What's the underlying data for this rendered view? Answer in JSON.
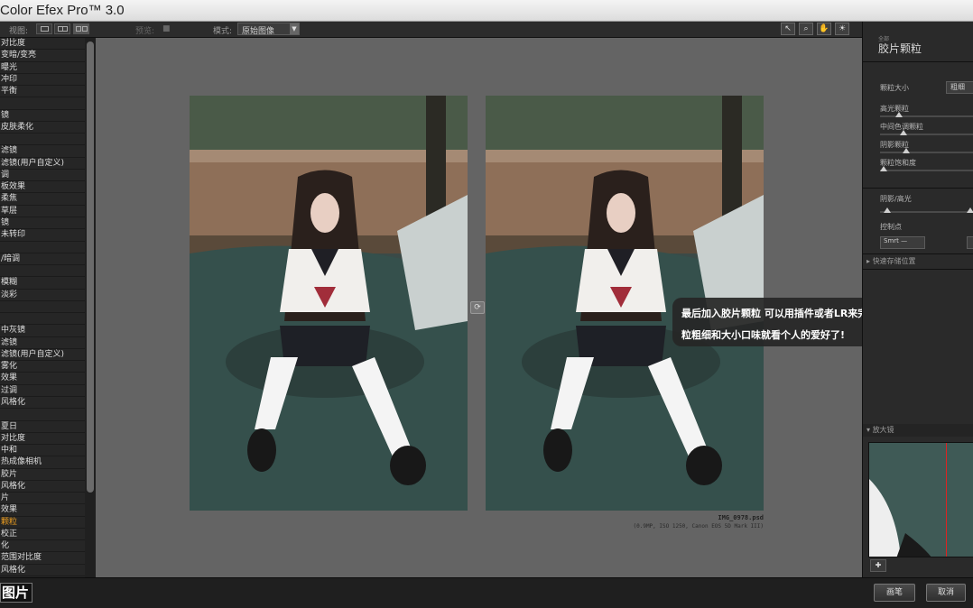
{
  "window": {
    "title": "Color Efex Pro™ 3.0"
  },
  "toolbar": {
    "view_label": "视图:",
    "preview_label": "预览:",
    "mode_label": "模式:",
    "mode_value": "原始图像"
  },
  "filter_list": [
    "对比度",
    "变暗/变亮",
    "曝光",
    "冲印",
    "平衡",
    "",
    "镜",
    "皮肤柔化",
    "",
    "滤镜",
    "滤镜(用户自定义)",
    "调",
    "板效果",
    "柔焦",
    "草层",
    "镜",
    "未转印",
    "",
    "/暗调",
    "",
    "模糊",
    "淡彩",
    "",
    "",
    "中灰镜",
    "滤镜",
    "滤镜(用户自定义)",
    "雾化",
    "效果",
    "过调",
    "风格化",
    "",
    "夏日",
    "对比度",
    "中和",
    "热成像相机",
    "胶片",
    "风格化",
    "片",
    "效果",
    "颗粒",
    "校正",
    "化",
    "范围对比度",
    "风格化"
  ],
  "filter_highlight": "颗粒",
  "preview": {
    "filename": "IMG_0978.psd",
    "fileinfo": "(0.9MP, ISO 1250, Canon EOS 5D Mark III)"
  },
  "caption": {
    "line1": "最后加入胶片颗粒 可以用插件或者LR来完成 至于颗",
    "line2": "粒粗细和大小口味就看个人的爱好了!"
  },
  "right_panel": {
    "category": "全部",
    "title": "胶片颗粒",
    "grain_size_label": "颗粒大小",
    "grain_size_value": "粗细",
    "sliders": [
      {
        "label": "高光颗粒",
        "value": 0.17
      },
      {
        "label": "中间色调颗粒",
        "value": 0.22
      },
      {
        "label": "阴影颗粒",
        "value": 0.25
      },
      {
        "label": "颗粒饱和度",
        "value": 0.0
      }
    ],
    "shadow_highlight_label": "阴影/高光",
    "control_points_label": "控制点",
    "control_points_button": "Smrt —",
    "quick_save_label": "快速存储位置",
    "loupe_label": "放大镜"
  },
  "bottom": {
    "left_label": "图片",
    "brush_label": "画笔",
    "cancel_label": "取消"
  },
  "colors": {
    "highlight": "#f0a020",
    "panel": "#2a2a2a",
    "preview_bg": "#646464"
  },
  "icons": [
    "single-view-icon",
    "split-view-icon",
    "side-by-side-icon",
    "pointer-icon",
    "zoom-icon",
    "hand-icon",
    "lightbulb-icon",
    "swap-icon",
    "pin-icon"
  ]
}
